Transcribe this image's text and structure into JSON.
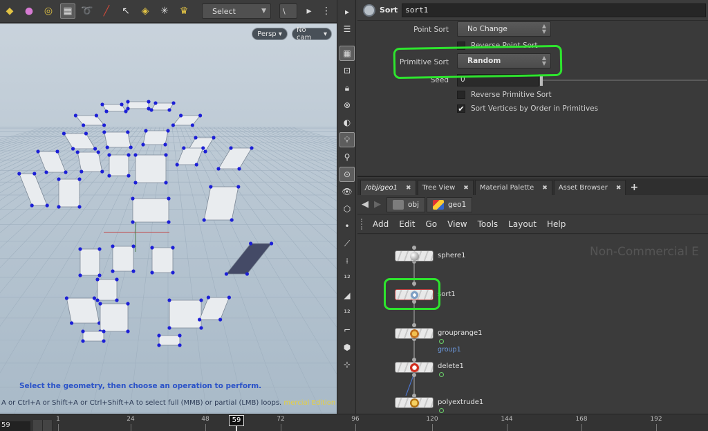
{
  "toolbar": {
    "icons": [
      "box-select-icon",
      "point-icon",
      "circle-icon",
      "lasso-icon",
      "brush-icon",
      "laser-icon",
      "pose-icon",
      "handle-icon",
      "magnet-icon",
      "crown-icon"
    ],
    "select_mode": "Select",
    "mode2": "\\"
  },
  "viewport": {
    "persp_label": "Persp",
    "cam_label": "No cam",
    "help_primary": "Select the geometry, then choose an operation to perform.",
    "help_secondary": "A or Ctrl+A or Shift+A or Ctrl+Shift+A to select full (MMB) or partial (LMB) loops.",
    "edition": "mercial Edition"
  },
  "params": {
    "node_type": "Sort",
    "node_name": "sort1",
    "point_sort_label": "Point Sort",
    "point_sort_value": "No Change",
    "reverse_point_sort": "Reverse Point Sort",
    "primitive_sort_label": "Primitive Sort",
    "primitive_sort_value": "Random",
    "seed_label": "Seed",
    "seed_value": "0",
    "reverse_primitive_sort": "Reverse Primitive Sort",
    "reverse_primitive_sort_checked": false,
    "sort_vertices": "Sort Vertices by Order in Primitives",
    "sort_vertices_checked": true
  },
  "network": {
    "tabs": [
      {
        "label": "/obj/geo1",
        "active": true
      },
      {
        "label": "Tree View",
        "active": false
      },
      {
        "label": "Material Palette",
        "active": false
      },
      {
        "label": "Asset Browser",
        "active": false
      }
    ],
    "breadcrumb": [
      "obj",
      "geo1"
    ],
    "menu": [
      "Add",
      "Edit",
      "Go",
      "View",
      "Tools",
      "Layout",
      "Help"
    ],
    "watermark": "Non-Commercial E",
    "nodes": [
      {
        "name": "sphere1",
        "icon_color": "#9aa4ae"
      },
      {
        "name": "sort1",
        "icon_color": "#b8c4d0"
      },
      {
        "name": "grouprange1",
        "icon_color": "#e0a020",
        "group": "group1"
      },
      {
        "name": "delete1",
        "icon_color": "#d03020"
      },
      {
        "name": "polyextrude1",
        "icon_color": "#e0b020"
      }
    ]
  },
  "timeline": {
    "current_frame": "59",
    "frame_field": "59",
    "ticks": [
      "1",
      "24",
      "48",
      "72",
      "96",
      "120",
      "144",
      "168",
      "192"
    ]
  },
  "colors": {
    "highlight": "#2ee52e",
    "point": "#1c1fd6"
  }
}
